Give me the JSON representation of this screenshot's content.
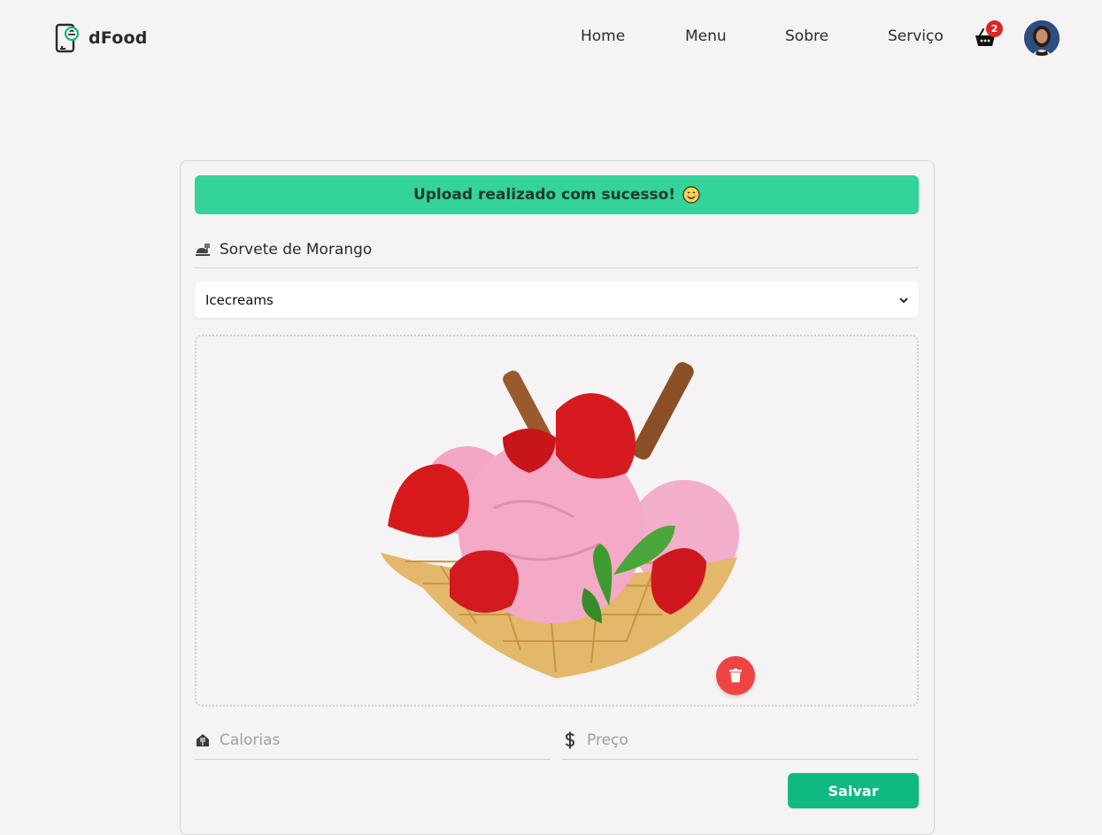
{
  "header": {
    "brand": "dFood",
    "nav": [
      {
        "label": "Home"
      },
      {
        "label": "Menu"
      },
      {
        "label": "Sobre"
      },
      {
        "label": "Serviço"
      }
    ],
    "cart_count": "2",
    "cart_icon": "basket-icon",
    "avatar_icon": "user-avatar"
  },
  "form": {
    "alert_text": "Upload realizado com sucesso!",
    "title_value": "Sorvete de Morango",
    "title_icon": "food-icon",
    "category_selected": "Icecreams",
    "image_description_icon": "icecream-image",
    "delete_icon": "trash-icon",
    "calories_placeholder": "Calorias",
    "calories_icon": "food-dome-icon",
    "price_placeholder": "Preço",
    "price_icon": "dollar-icon",
    "save_label": "Salvar"
  },
  "colors": {
    "alert_bg": "#34d399",
    "save_bg": "#10b981",
    "delete_bg": "#ef4444",
    "badge_bg": "#dc2626",
    "page_bg": "#f5f3f4"
  }
}
